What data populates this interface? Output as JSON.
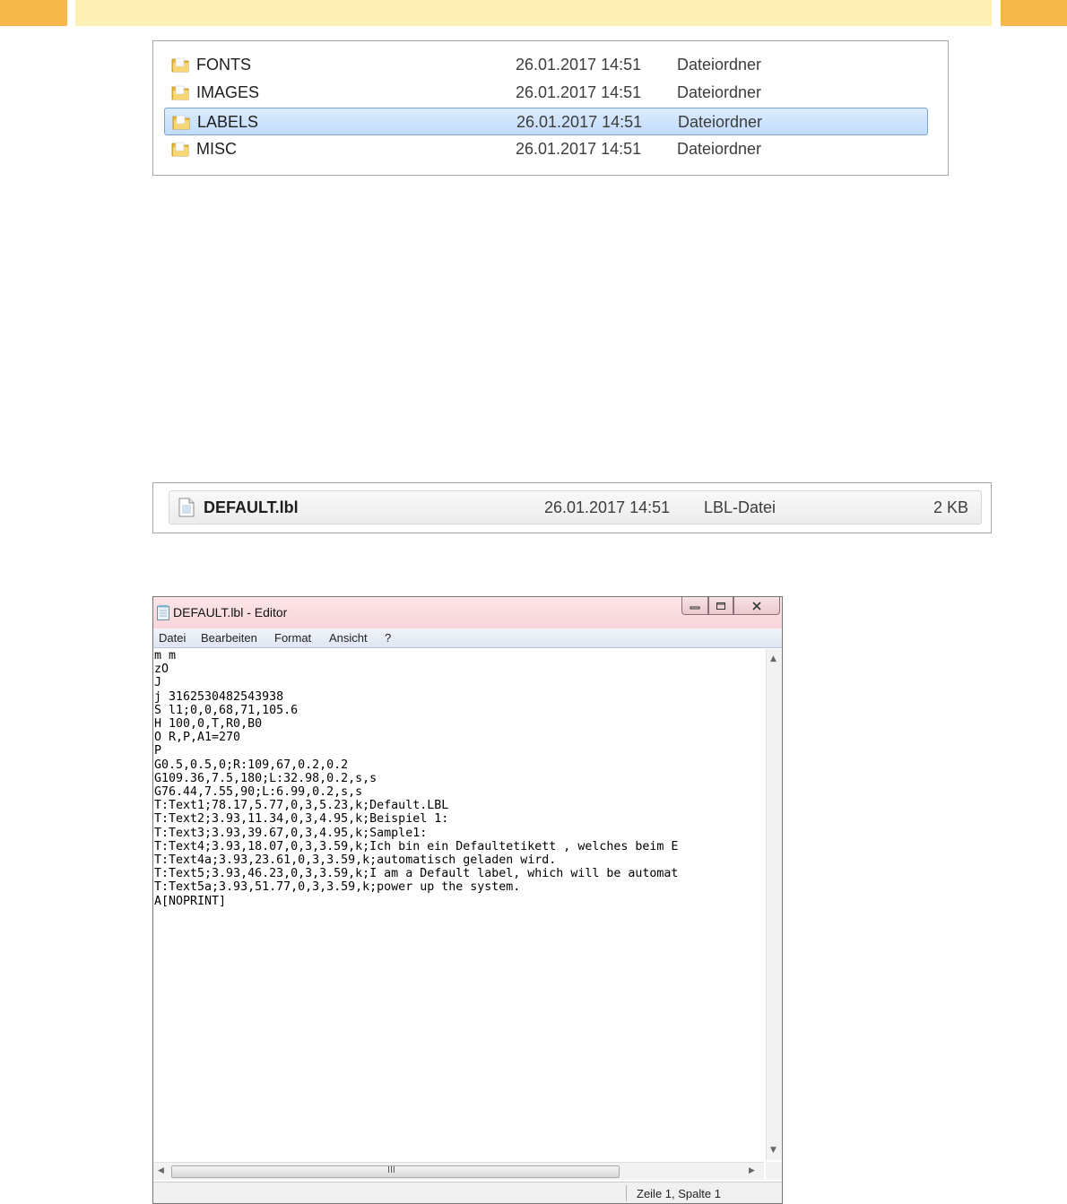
{
  "folders": [
    {
      "name": "FONTS",
      "date": "26.01.2017 14:51",
      "type": "Dateiordner"
    },
    {
      "name": "IMAGES",
      "date": "26.01.2017 14:51",
      "type": "Dateiordner"
    },
    {
      "name": "LABELS",
      "date": "26.01.2017 14:51",
      "type": "Dateiordner",
      "selected": true
    },
    {
      "name": "MISC",
      "date": "26.01.2017 14:51",
      "type": "Dateiordner"
    }
  ],
  "file": {
    "name": "DEFAULT.lbl",
    "date": "26.01.2017 14:51",
    "type": "LBL-Datei",
    "size": "2 KB"
  },
  "editor": {
    "title": "DEFAULT.lbl - Editor",
    "menu": [
      "Datei",
      "Bearbeiten",
      "Format",
      "Ansicht",
      "?"
    ],
    "lines": [
      "m m",
      "zO",
      "J",
      "j 3162530482543938",
      "S l1;0,0,68,71,105.6",
      "H 100,0,T,R0,B0",
      "O R,P,A1=270",
      "P",
      "G0.5,0.5,0;R:109,67,0.2,0.2",
      "G109.36,7.5,180;L:32.98,0.2,s,s",
      "G76.44,7.55,90;L:6.99,0.2,s,s",
      "T:Text1;78.17,5.77,0,3,5.23,k;Default.LBL",
      "T:Text2;3.93,11.34,0,3,4.95,k;Beispiel 1:",
      "T:Text3;3.93,39.67,0,3,4.95,k;Sample1:",
      "T:Text4;3.93,18.07,0,3,3.59,k;Ich bin ein Defaultetikett , welches beim E",
      "T:Text4a;3.93,23.61,0,3,3.59,k;automatisch geladen wird.",
      "T:Text5;3.93,46.23,0,3,3.59,k;I am a Default label, which will be automat",
      "T:Text5a;3.93,51.77,0,3,3.59,k;power up the system.",
      "A[NOPRINT]"
    ],
    "scroll_grip": "III",
    "status": "Zeile 1, Spalte 1"
  },
  "colors": {
    "header_accent": "#f6b84a",
    "header_band": "#fdf0b4",
    "selection": "#c1dcfc",
    "titlebar": "#f7d6da"
  }
}
